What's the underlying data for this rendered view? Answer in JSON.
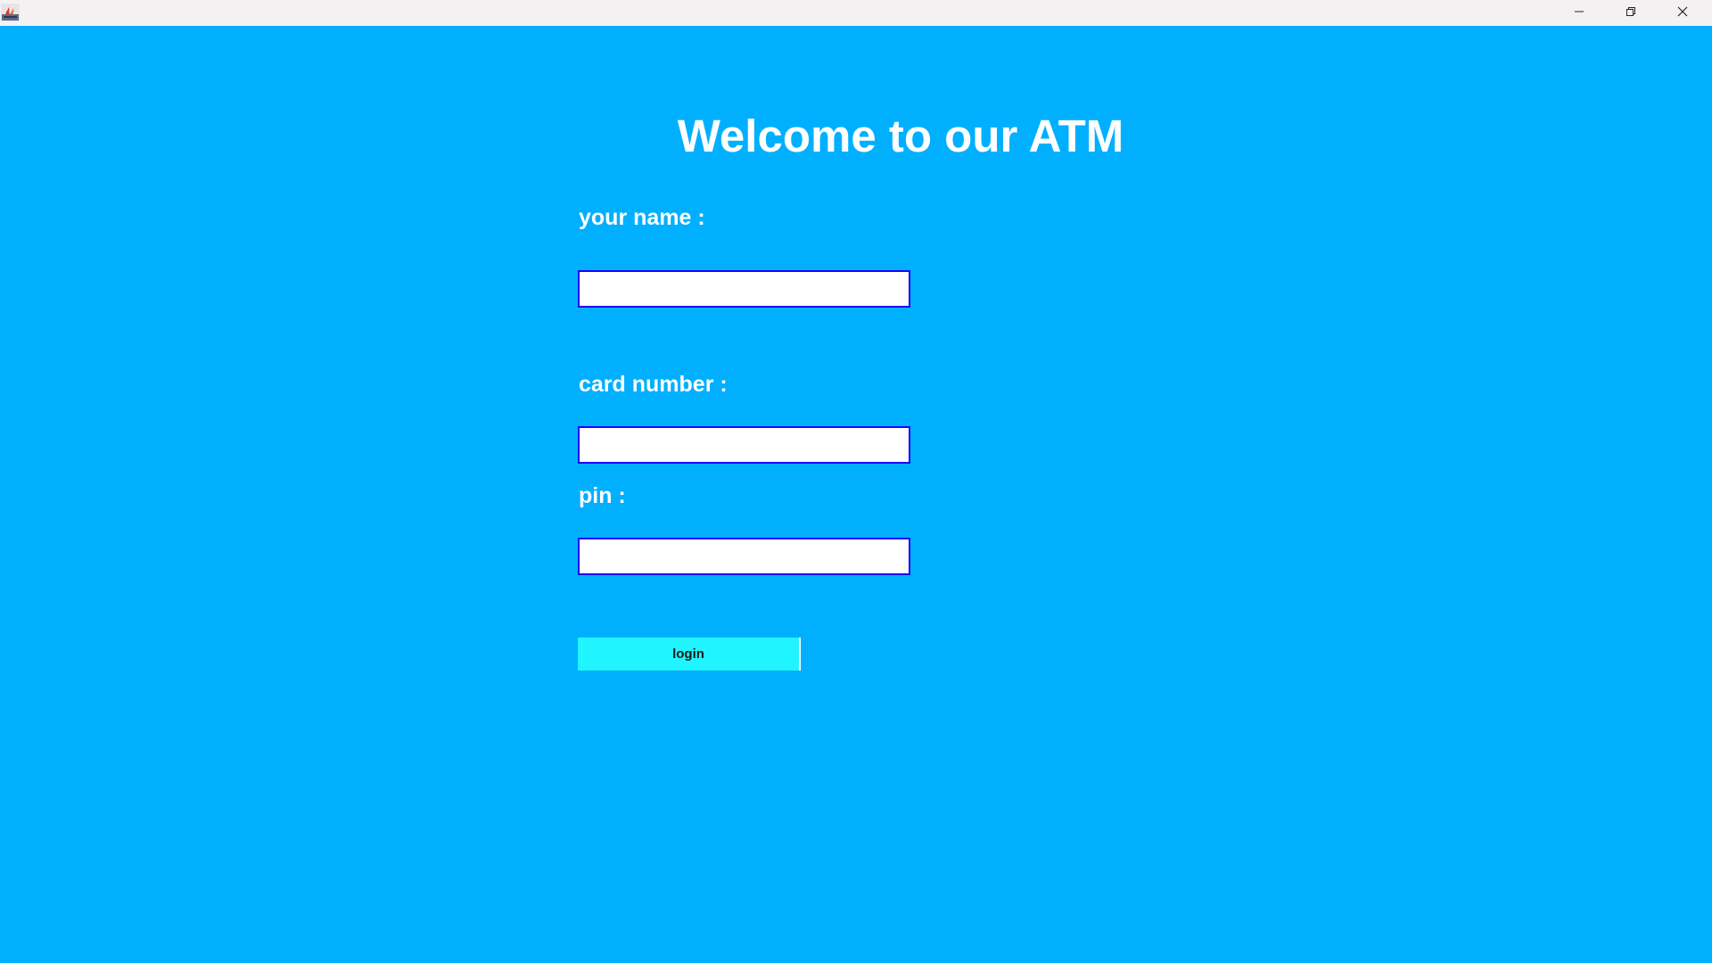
{
  "window": {
    "background": "#00b0ff",
    "icon": "java-app-icon",
    "controls": {
      "minimize_icon": "minimize-icon",
      "maximize_icon": "restore-icon",
      "close_icon": "close-icon"
    }
  },
  "form": {
    "title": "Welcome to our ATM",
    "name_label": "your name :",
    "name_value": "",
    "card_label": "card number :",
    "card_value": "",
    "pin_label": "pin :",
    "pin_value": "",
    "login_label": "login",
    "field_border_color": "#1a00ff",
    "button_color": "#1ff4ff"
  }
}
